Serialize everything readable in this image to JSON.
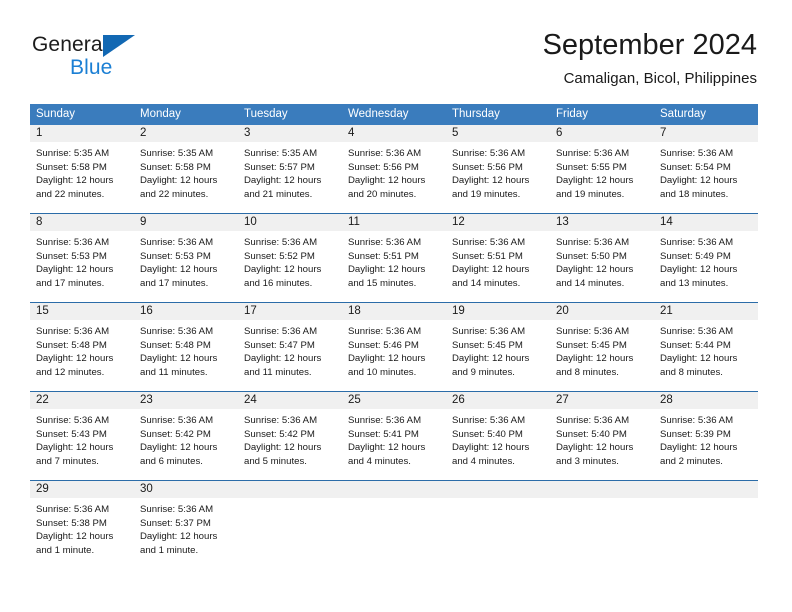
{
  "brand": {
    "name_part1": "General",
    "name_part2": "Blue",
    "logo_icon": "triangle-flag-icon"
  },
  "header": {
    "title": "September 2024",
    "subtitle": "Camaligan, Bicol, Philippines"
  },
  "colors": {
    "header_blue": "#3a7cbd",
    "row_rule_blue": "#2b6ca8",
    "daynum_band": "#f0f0f0",
    "brand_blue": "#1b7fd4",
    "logo_blue": "#1268b3"
  },
  "weekdays": [
    "Sunday",
    "Monday",
    "Tuesday",
    "Wednesday",
    "Thursday",
    "Friday",
    "Saturday"
  ],
  "weeks": [
    [
      {
        "day": "1",
        "sunrise": "Sunrise: 5:35 AM",
        "sunset": "Sunset: 5:58 PM",
        "daylight1": "Daylight: 12 hours",
        "daylight2": "and 22 minutes."
      },
      {
        "day": "2",
        "sunrise": "Sunrise: 5:35 AM",
        "sunset": "Sunset: 5:58 PM",
        "daylight1": "Daylight: 12 hours",
        "daylight2": "and 22 minutes."
      },
      {
        "day": "3",
        "sunrise": "Sunrise: 5:35 AM",
        "sunset": "Sunset: 5:57 PM",
        "daylight1": "Daylight: 12 hours",
        "daylight2": "and 21 minutes."
      },
      {
        "day": "4",
        "sunrise": "Sunrise: 5:36 AM",
        "sunset": "Sunset: 5:56 PM",
        "daylight1": "Daylight: 12 hours",
        "daylight2": "and 20 minutes."
      },
      {
        "day": "5",
        "sunrise": "Sunrise: 5:36 AM",
        "sunset": "Sunset: 5:56 PM",
        "daylight1": "Daylight: 12 hours",
        "daylight2": "and 19 minutes."
      },
      {
        "day": "6",
        "sunrise": "Sunrise: 5:36 AM",
        "sunset": "Sunset: 5:55 PM",
        "daylight1": "Daylight: 12 hours",
        "daylight2": "and 19 minutes."
      },
      {
        "day": "7",
        "sunrise": "Sunrise: 5:36 AM",
        "sunset": "Sunset: 5:54 PM",
        "daylight1": "Daylight: 12 hours",
        "daylight2": "and 18 minutes."
      }
    ],
    [
      {
        "day": "8",
        "sunrise": "Sunrise: 5:36 AM",
        "sunset": "Sunset: 5:53 PM",
        "daylight1": "Daylight: 12 hours",
        "daylight2": "and 17 minutes."
      },
      {
        "day": "9",
        "sunrise": "Sunrise: 5:36 AM",
        "sunset": "Sunset: 5:53 PM",
        "daylight1": "Daylight: 12 hours",
        "daylight2": "and 17 minutes."
      },
      {
        "day": "10",
        "sunrise": "Sunrise: 5:36 AM",
        "sunset": "Sunset: 5:52 PM",
        "daylight1": "Daylight: 12 hours",
        "daylight2": "and 16 minutes."
      },
      {
        "day": "11",
        "sunrise": "Sunrise: 5:36 AM",
        "sunset": "Sunset: 5:51 PM",
        "daylight1": "Daylight: 12 hours",
        "daylight2": "and 15 minutes."
      },
      {
        "day": "12",
        "sunrise": "Sunrise: 5:36 AM",
        "sunset": "Sunset: 5:51 PM",
        "daylight1": "Daylight: 12 hours",
        "daylight2": "and 14 minutes."
      },
      {
        "day": "13",
        "sunrise": "Sunrise: 5:36 AM",
        "sunset": "Sunset: 5:50 PM",
        "daylight1": "Daylight: 12 hours",
        "daylight2": "and 14 minutes."
      },
      {
        "day": "14",
        "sunrise": "Sunrise: 5:36 AM",
        "sunset": "Sunset: 5:49 PM",
        "daylight1": "Daylight: 12 hours",
        "daylight2": "and 13 minutes."
      }
    ],
    [
      {
        "day": "15",
        "sunrise": "Sunrise: 5:36 AM",
        "sunset": "Sunset: 5:48 PM",
        "daylight1": "Daylight: 12 hours",
        "daylight2": "and 12 minutes."
      },
      {
        "day": "16",
        "sunrise": "Sunrise: 5:36 AM",
        "sunset": "Sunset: 5:48 PM",
        "daylight1": "Daylight: 12 hours",
        "daylight2": "and 11 minutes."
      },
      {
        "day": "17",
        "sunrise": "Sunrise: 5:36 AM",
        "sunset": "Sunset: 5:47 PM",
        "daylight1": "Daylight: 12 hours",
        "daylight2": "and 11 minutes."
      },
      {
        "day": "18",
        "sunrise": "Sunrise: 5:36 AM",
        "sunset": "Sunset: 5:46 PM",
        "daylight1": "Daylight: 12 hours",
        "daylight2": "and 10 minutes."
      },
      {
        "day": "19",
        "sunrise": "Sunrise: 5:36 AM",
        "sunset": "Sunset: 5:45 PM",
        "daylight1": "Daylight: 12 hours",
        "daylight2": "and 9 minutes."
      },
      {
        "day": "20",
        "sunrise": "Sunrise: 5:36 AM",
        "sunset": "Sunset: 5:45 PM",
        "daylight1": "Daylight: 12 hours",
        "daylight2": "and 8 minutes."
      },
      {
        "day": "21",
        "sunrise": "Sunrise: 5:36 AM",
        "sunset": "Sunset: 5:44 PM",
        "daylight1": "Daylight: 12 hours",
        "daylight2": "and 8 minutes."
      }
    ],
    [
      {
        "day": "22",
        "sunrise": "Sunrise: 5:36 AM",
        "sunset": "Sunset: 5:43 PM",
        "daylight1": "Daylight: 12 hours",
        "daylight2": "and 7 minutes."
      },
      {
        "day": "23",
        "sunrise": "Sunrise: 5:36 AM",
        "sunset": "Sunset: 5:42 PM",
        "daylight1": "Daylight: 12 hours",
        "daylight2": "and 6 minutes."
      },
      {
        "day": "24",
        "sunrise": "Sunrise: 5:36 AM",
        "sunset": "Sunset: 5:42 PM",
        "daylight1": "Daylight: 12 hours",
        "daylight2": "and 5 minutes."
      },
      {
        "day": "25",
        "sunrise": "Sunrise: 5:36 AM",
        "sunset": "Sunset: 5:41 PM",
        "daylight1": "Daylight: 12 hours",
        "daylight2": "and 4 minutes."
      },
      {
        "day": "26",
        "sunrise": "Sunrise: 5:36 AM",
        "sunset": "Sunset: 5:40 PM",
        "daylight1": "Daylight: 12 hours",
        "daylight2": "and 4 minutes."
      },
      {
        "day": "27",
        "sunrise": "Sunrise: 5:36 AM",
        "sunset": "Sunset: 5:40 PM",
        "daylight1": "Daylight: 12 hours",
        "daylight2": "and 3 minutes."
      },
      {
        "day": "28",
        "sunrise": "Sunrise: 5:36 AM",
        "sunset": "Sunset: 5:39 PM",
        "daylight1": "Daylight: 12 hours",
        "daylight2": "and 2 minutes."
      }
    ],
    [
      {
        "day": "29",
        "sunrise": "Sunrise: 5:36 AM",
        "sunset": "Sunset: 5:38 PM",
        "daylight1": "Daylight: 12 hours",
        "daylight2": "and 1 minute."
      },
      {
        "day": "30",
        "sunrise": "Sunrise: 5:36 AM",
        "sunset": "Sunset: 5:37 PM",
        "daylight1": "Daylight: 12 hours",
        "daylight2": "and 1 minute."
      },
      {
        "day": "",
        "sunrise": "",
        "sunset": "",
        "daylight1": "",
        "daylight2": ""
      },
      {
        "day": "",
        "sunrise": "",
        "sunset": "",
        "daylight1": "",
        "daylight2": ""
      },
      {
        "day": "",
        "sunrise": "",
        "sunset": "",
        "daylight1": "",
        "daylight2": ""
      },
      {
        "day": "",
        "sunrise": "",
        "sunset": "",
        "daylight1": "",
        "daylight2": ""
      },
      {
        "day": "",
        "sunrise": "",
        "sunset": "",
        "daylight1": "",
        "daylight2": ""
      }
    ]
  ]
}
